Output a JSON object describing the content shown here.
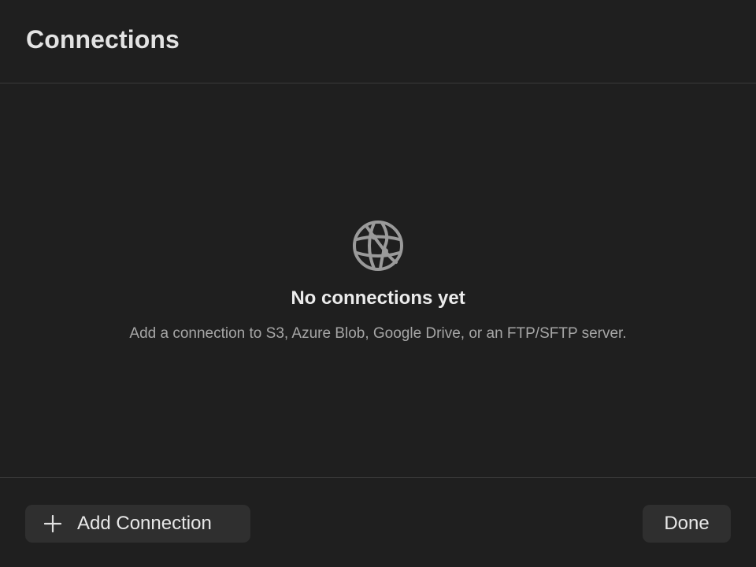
{
  "header": {
    "title": "Connections"
  },
  "empty_state": {
    "icon": "globe-icon",
    "title": "No connections yet",
    "subtitle": "Add a connection to S3, Azure Blob, Google Drive, or an FTP/SFTP server."
  },
  "footer": {
    "add_button": {
      "label": "Add Connection",
      "icon": "plus-icon"
    },
    "done_button": {
      "label": "Done"
    }
  },
  "colors": {
    "background": "#1f1f1f",
    "button": "#2f2f2f",
    "divider": "#3a3a3a",
    "muted_text": "#a6a6a6"
  }
}
